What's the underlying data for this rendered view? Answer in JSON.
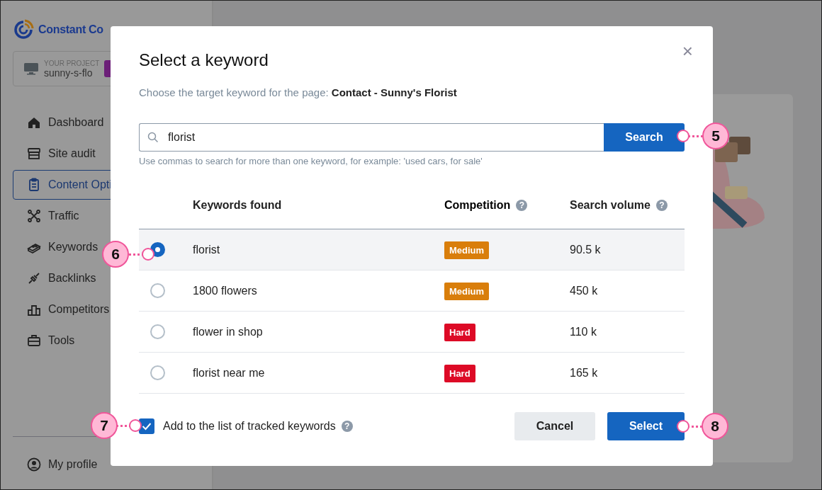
{
  "sidebar": {
    "brand": "Constant Co",
    "project": {
      "caption": "YOUR PROJECT",
      "name": "sunny-s-flo"
    },
    "items": [
      {
        "label": "Dashboard",
        "selected": false
      },
      {
        "label": "Site audit",
        "selected": false
      },
      {
        "label": "Content Opti",
        "selected": true
      },
      {
        "label": "Traffic",
        "selected": false
      },
      {
        "label": "Keywords",
        "selected": false
      },
      {
        "label": "Backlinks",
        "selected": false
      },
      {
        "label": "Competitors",
        "selected": false
      },
      {
        "label": "Tools",
        "selected": false
      }
    ],
    "footer": {
      "label": "My profile"
    }
  },
  "dialog": {
    "title": "Select a keyword",
    "close": "×",
    "subtitle": "Choose the target keyword for the page: **Contact - Sunny's Florist**",
    "search": {
      "value": "florist",
      "button": "Search",
      "hint": "Use commas to search for more than one keyword, for example: 'used cars, for sale'"
    },
    "table": {
      "columns": [
        {
          "label": "Keywords found"
        },
        {
          "label": "Competition",
          "help": "?"
        },
        {
          "label": "Search volume",
          "help": "?"
        }
      ],
      "rows": [
        {
          "keyword": "florist",
          "competition": "Medium",
          "color": "#d97e0b",
          "volume": "90.5 k",
          "selected": true
        },
        {
          "keyword": "1800 flowers",
          "competition": "Medium",
          "color": "#d97e0b",
          "volume": "450 k",
          "selected": false
        },
        {
          "keyword": "flower in shop",
          "competition": "Hard",
          "color": "#dd0a26",
          "volume": "110 k",
          "selected": false
        },
        {
          "keyword": "florist near me",
          "competition": "Hard",
          "color": "#dd0a26",
          "volume": "165 k",
          "selected": false
        }
      ]
    },
    "track": {
      "label": "Add to the list of tracked keywords",
      "help": "?",
      "checked": true
    },
    "buttons": [
      {
        "label": "Cancel",
        "kind": "secondary"
      },
      {
        "label": "Select",
        "kind": "primary"
      }
    ]
  },
  "callouts": [
    {
      "label": "5"
    },
    {
      "label": "6"
    },
    {
      "label": "7"
    },
    {
      "label": "8"
    }
  ]
}
